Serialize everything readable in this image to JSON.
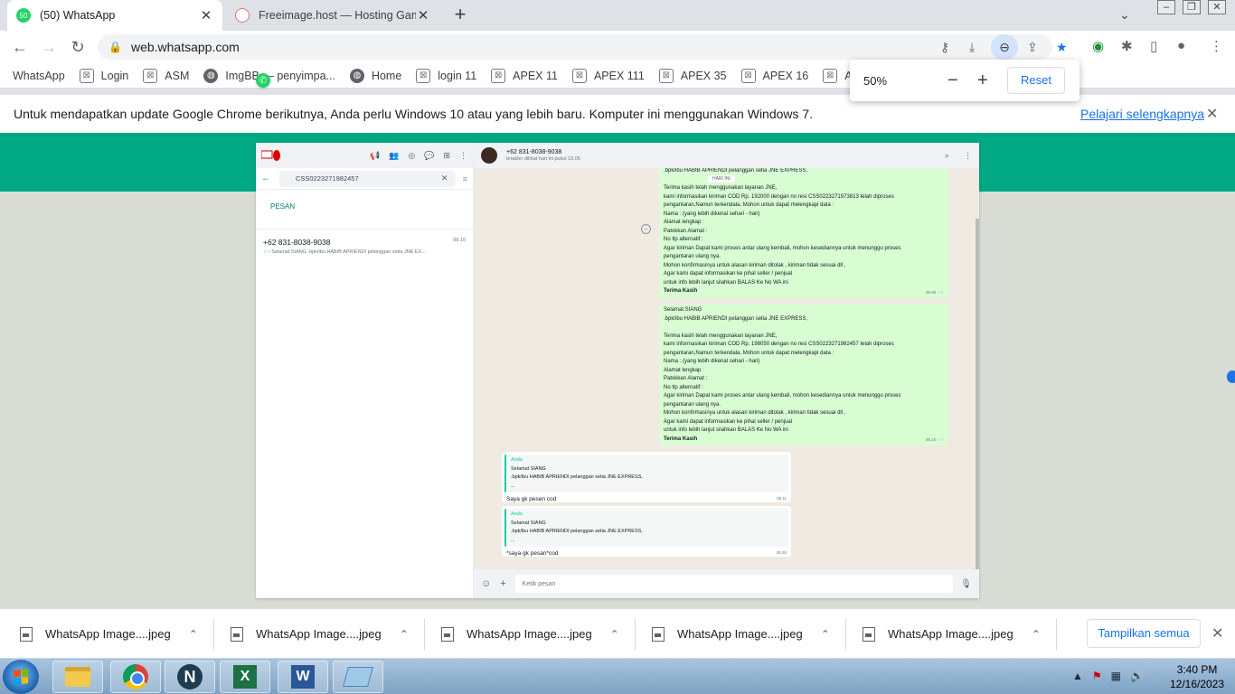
{
  "browser": {
    "tabs": [
      {
        "title": "(50) WhatsApp",
        "badge": "50"
      },
      {
        "title": "Freeimage.host — Hosting Gamb"
      }
    ],
    "url": "web.whatsapp.com",
    "bookmarks": [
      {
        "label": "WhatsApp",
        "icon": "whatsapp-icon"
      },
      {
        "label": "Login",
        "icon": "puzzle-icon"
      },
      {
        "label": "ASM",
        "icon": "puzzle-icon"
      },
      {
        "label": "ImgBB — penyimpa...",
        "icon": "globe-icon"
      },
      {
        "label": "Home",
        "icon": "globe-icon"
      },
      {
        "label": "login 11",
        "icon": "puzzle-icon"
      },
      {
        "label": "APEX 11",
        "icon": "puzzle-icon"
      },
      {
        "label": "APEX 111",
        "icon": "puzzle-icon"
      },
      {
        "label": "APEX 35",
        "icon": "puzzle-icon"
      },
      {
        "label": "APEX 16",
        "icon": "puzzle-icon"
      },
      {
        "label": "ASI",
        "icon": "puzzle-icon"
      }
    ],
    "infobar": {
      "message": "Untuk mendapatkan update Google Chrome berikutnya, Anda perlu Windows 10 atau yang lebih baru. Komputer ini menggunakan Windows 7.",
      "link": "Pelajari selengkapnya"
    },
    "zoom": {
      "level": "50%",
      "reset_label": "Reset"
    }
  },
  "whatsapp": {
    "search_query": "CSS0223271982457",
    "section_label": "PESAN",
    "result": {
      "name": "+62 831-8038-9038",
      "time": "09.10",
      "preview": "Selamat SIANG .bpk/ibu HABIB APRIENDI pelanggan setia JNE EX..."
    },
    "contact": {
      "name": "+62 831-8038-9038",
      "last_seen": "terakhir dilihat hari ini pukul 15.05"
    },
    "date_chip": "HARI INI",
    "messages": [
      {
        "lines": [
          ".bpk/ibu HABIB APRIENDI pelanggan setia JNE EXPRESS,",
          "",
          "Terima kasih telah menggunakan layanan JNE,",
          "kami informasikan kiriman COD  Rp. 192000 dengan no resi CSS0223271973813 telah diproses",
          "pengantaran,Namun terkendala, Mohon untuk dapat melengkapi data :",
          "Nama : (yang lebih dikenal sehari - hari)",
          "Alamat  lengkap :",
          "Patokkan Alamat :",
          "No tlp alternatif :",
          "Agar kiriman Dapat kami proses antar ulang kembali, mohon kesediannya untuk menunggu proses",
          "pengantaran ulang nya.",
          "Mohon konfirmasinya untuk alasan kiriman ditolak , kiriman tidak sesuai dll ,",
          "Agar kami dapat informasikan ke pihal seller / penjual",
          "untuk info lebih lanjut silahkan BALAS Ke No WA ini",
          "Terima Kasih"
        ],
        "time": "09.09"
      },
      {
        "lines": [
          "Selamat SIANG",
          ".bpk/ibu HABIB APRIENDI pelanggan setia JNE EXPRESS,",
          "",
          "Terima kasih telah menggunakan layanan JNE,",
          "kami informasikan kiriman COD  Rp. 198050 dengan no resi CSS0223271982457 telah diproses",
          "pengantaran,Namun terkendala, Mohon untuk dapat melengkapi data :",
          "Nama : (yang lebih dikenal sehari - hari)",
          "Alamat  lengkap :",
          "Patokkan Alamat :",
          "No tlp alternatif :",
          "Agar kiriman Dapat kami proses antar ulang kembali, mohon kesediannya untuk menunggu proses",
          "pengantaran ulang nya.",
          "Mohon konfirmasinya untuk alasan kiriman ditolak , kiriman tidak sesuai dll ,",
          "Agar kami dapat informasikan ke pihal seller / penjual",
          "untuk info lebih lanjut silahkan BALAS Ke No WA ini",
          "Terima Kasih"
        ],
        "time": "09.10"
      }
    ],
    "replies": [
      {
        "quote_author": "Anda",
        "quote_l1": "Selamat SIANG",
        "quote_l2": ".bpk/ibu HABIB APRIENDI pelanggan setia JNE EXPRESS,",
        "quote_l3": "...",
        "text": "Saya gk pesen cod",
        "time": "09.11"
      },
      {
        "quote_author": "Anda",
        "quote_l1": "Selamat SIANG",
        "quote_l2": ".bpk/ibu HABIB APRIENDI pelanggan setia JNE EXPRESS,",
        "quote_l3": "...",
        "text": "*saya gk pesan*cod",
        "time": "09.26"
      }
    ],
    "composer_placeholder": "Ketik pesan"
  },
  "downloads": {
    "items": [
      "WhatsApp Image....jpeg",
      "WhatsApp Image....jpeg",
      "WhatsApp Image....jpeg",
      "WhatsApp Image....jpeg",
      "WhatsApp Image....jpeg"
    ],
    "show_all": "Tampilkan semua"
  },
  "taskbar": {
    "time": "3:40 PM",
    "date": "12/16/2023"
  },
  "colors": {
    "whatsapp_green": "#00a884",
    "incoming_bubble": "#d9fdd3",
    "chrome_blue": "#1a73e8"
  }
}
